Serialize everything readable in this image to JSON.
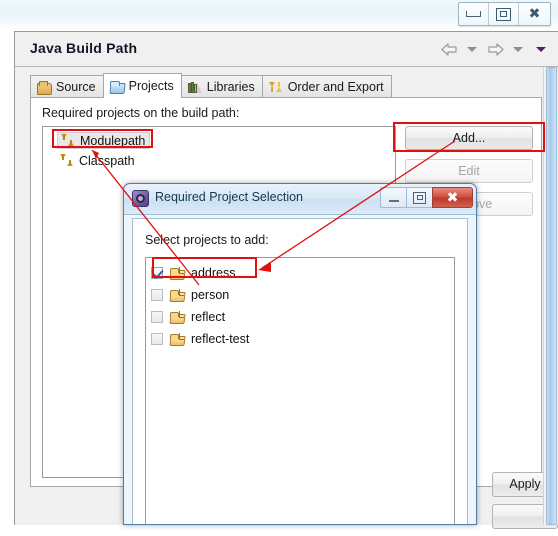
{
  "window": {
    "controls": [
      {
        "name": "minimize",
        "glyph": "minimize-icon"
      },
      {
        "name": "restore",
        "glyph": "restore-icon"
      },
      {
        "name": "close",
        "glyph": "close-icon"
      }
    ]
  },
  "page": {
    "title": "Java Build Path",
    "nav": {
      "back_label": "Back",
      "back_menu_label": "Back history",
      "forward_label": "Forward",
      "forward_menu_label": "Forward history",
      "view_menu_label": "View menu"
    },
    "tabs": [
      {
        "label": "Source",
        "icon": "source-folder-icon",
        "active": false
      },
      {
        "label": "Projects",
        "icon": "projects-folder-icon",
        "active": true
      },
      {
        "label": "Libraries",
        "icon": "libraries-books-icon",
        "active": false
      },
      {
        "label": "Order and Export",
        "icon": "order-export-arrows-icon",
        "active": false
      }
    ],
    "projects_tab": {
      "required_label": "Required projects on the build path:",
      "tree": [
        {
          "label": "Modulepath",
          "icon": "build-path-entry-icon",
          "selected": true,
          "highlighted": true
        },
        {
          "label": "Classpath",
          "icon": "build-path-entry-icon",
          "selected": false,
          "highlighted": false
        }
      ],
      "buttons": [
        {
          "label": "Add...",
          "enabled": true,
          "highlighted": true
        },
        {
          "label": "Edit",
          "enabled": false,
          "highlighted": false
        },
        {
          "label": "Remove",
          "enabled": false,
          "highlighted": false
        }
      ]
    },
    "footer_buttons": [
      {
        "label": "Apply",
        "enabled": true
      },
      {
        "label": "",
        "enabled": true
      }
    ]
  },
  "dialog": {
    "title": "Required Project Selection",
    "icon": "eclipse-app-icon",
    "controls": [
      {
        "name": "minimize",
        "glyph": "minimize-icon"
      },
      {
        "name": "restore",
        "glyph": "restore-icon"
      },
      {
        "name": "close",
        "glyph": "close-icon"
      }
    ],
    "prompt": "Select projects to add:",
    "projects": [
      {
        "label": "address",
        "checked": true,
        "icon": "project-folder-icon",
        "highlighted": true
      },
      {
        "label": "person",
        "checked": false,
        "icon": "project-folder-icon",
        "highlighted": false
      },
      {
        "label": "reflect",
        "checked": false,
        "icon": "project-folder-icon",
        "highlighted": false
      },
      {
        "label": "reflect-test",
        "checked": false,
        "icon": "project-folder-icon",
        "highlighted": false
      }
    ]
  },
  "annotations": {
    "color": "#e2110f",
    "arrows": [
      {
        "from": "address-row",
        "to": "tree-item-modulepath"
      },
      {
        "from": "add-button",
        "to": "address-row"
      }
    ]
  }
}
